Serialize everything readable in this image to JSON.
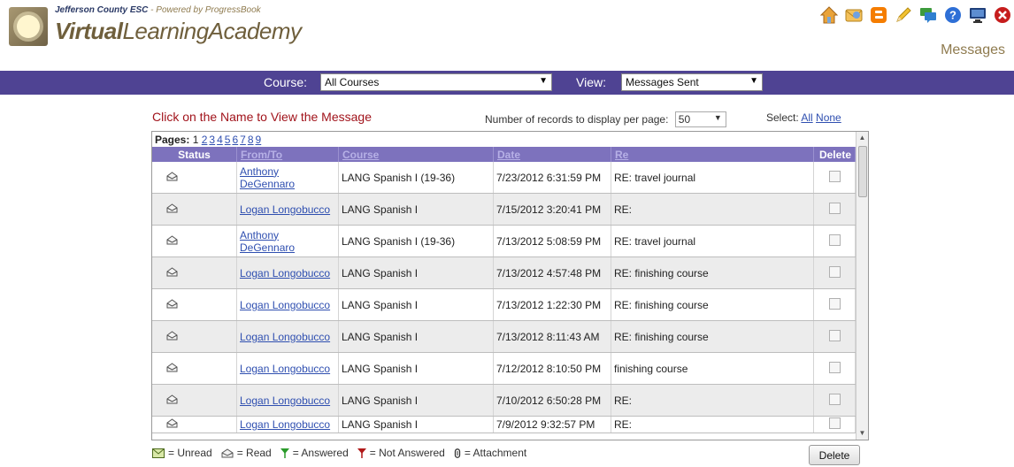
{
  "header": {
    "org_name": "Jefferson County ESC",
    "powered_by": "- Powered by ProgressBook",
    "brand_bold": "Virtual",
    "brand_rest": "LearningAcademy",
    "page_title": "Messages",
    "icons": [
      "home-icon",
      "mail-icon",
      "blogger-icon",
      "pencil-icon",
      "chat-icon",
      "help-icon",
      "monitor-icon",
      "close-icon"
    ]
  },
  "filters": {
    "course_label": "Course:",
    "course_value": "All Courses",
    "view_label": "View:",
    "view_value": "Messages Sent"
  },
  "main": {
    "instructions": "Click on the Name to View the Message",
    "records_label": "Number of records to display per page:",
    "records_value": "50",
    "select_label": "Select:",
    "select_all": "All",
    "select_none": "None",
    "pages_label": "Pages:",
    "current_page": "1",
    "pages": [
      "2",
      "3",
      "4",
      "5",
      "6",
      "7",
      "8",
      "9"
    ]
  },
  "table": {
    "headers": {
      "status": "Status",
      "from_to": "From/To",
      "course": "Course",
      "date": "Date",
      "re": "Re",
      "delete": "Delete"
    },
    "rows": [
      {
        "from": "Anthony DeGennaro",
        "course": "LANG Spanish I (19-36)",
        "date": "7/23/2012 6:31:59 PM",
        "re": "RE: travel journal"
      },
      {
        "from": "Logan Longobucco",
        "course": "LANG Spanish I",
        "date": "7/15/2012 3:20:41 PM",
        "re": "RE:"
      },
      {
        "from": "Anthony DeGennaro",
        "course": "LANG Spanish I (19-36)",
        "date": "7/13/2012 5:08:59 PM",
        "re": "RE: travel journal"
      },
      {
        "from": "Logan Longobucco",
        "course": "LANG Spanish I",
        "date": "7/13/2012 4:57:48 PM",
        "re": "RE: finishing course"
      },
      {
        "from": "Logan Longobucco",
        "course": "LANG Spanish I",
        "date": "7/13/2012 1:22:30 PM",
        "re": "RE: finishing course"
      },
      {
        "from": "Logan Longobucco",
        "course": "LANG Spanish I",
        "date": "7/13/2012 8:11:43 AM",
        "re": "RE: finishing course"
      },
      {
        "from": "Logan Longobucco",
        "course": "LANG Spanish I",
        "date": "7/12/2012 8:10:50 PM",
        "re": "finishing course"
      },
      {
        "from": "Logan Longobucco",
        "course": "LANG Spanish I",
        "date": "7/10/2012 6:50:28 PM",
        "re": "RE:"
      },
      {
        "from": "Logan Longobucco",
        "course": "LANG Spanish I",
        "date": "7/9/2012 9:32:57 PM",
        "re": "RE:"
      }
    ]
  },
  "legend": {
    "unread": "= Unread",
    "read": "= Read",
    "answered": "= Answered",
    "not_answered": "= Not Answered",
    "attachment": "= Attachment"
  },
  "footer": {
    "delete_button": "Delete"
  },
  "colors": {
    "filter_bar": "#4f4393",
    "table_header": "#7d72bd",
    "instructions": "#a1131b",
    "link": "#2f4fb0"
  }
}
